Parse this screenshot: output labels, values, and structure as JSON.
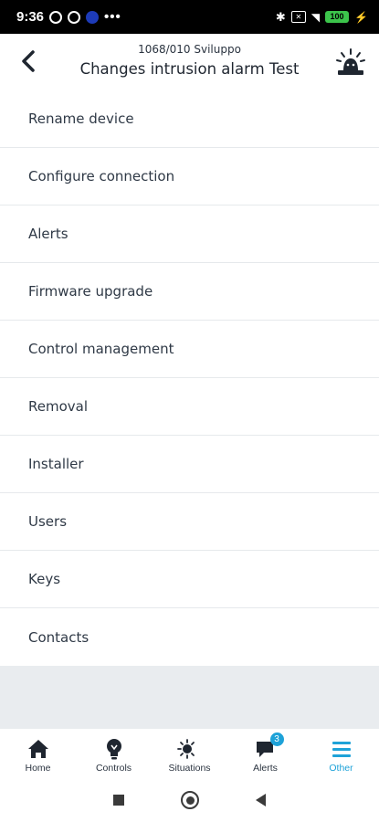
{
  "status_bar": {
    "time": "9:36",
    "battery": "100",
    "more": "•••"
  },
  "header": {
    "subtitle": "1068/010 Sviluppo",
    "title": "Changes intrusion alarm Test"
  },
  "menu": {
    "items": [
      {
        "label": "Rename device"
      },
      {
        "label": "Configure connection"
      },
      {
        "label": "Alerts"
      },
      {
        "label": "Firmware upgrade"
      },
      {
        "label": "Control management"
      },
      {
        "label": "Removal"
      },
      {
        "label": "Installer"
      },
      {
        "label": "Users"
      },
      {
        "label": "Keys"
      },
      {
        "label": "Contacts"
      }
    ]
  },
  "bottom_nav": {
    "items": [
      {
        "label": "Home",
        "icon": "home-icon"
      },
      {
        "label": "Controls",
        "icon": "lightbulb-icon"
      },
      {
        "label": "Situations",
        "icon": "sun-moon-icon"
      },
      {
        "label": "Alerts",
        "icon": "chat-icon",
        "badge": "3"
      },
      {
        "label": "Other",
        "icon": "menu-icon",
        "active": true
      }
    ]
  },
  "colors": {
    "accent": "#1ea2d8",
    "text": "#2b3440",
    "background": "#e9ecef"
  }
}
